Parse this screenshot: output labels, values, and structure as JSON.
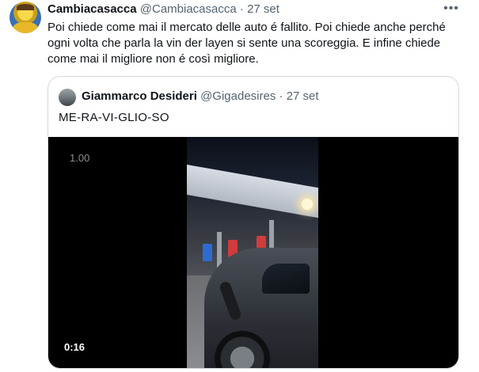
{
  "tweet": {
    "author_name": "Cambiacasacca",
    "author_handle": "@Cambiacasacca",
    "separator": "·",
    "date": "27 set",
    "more_icon": "more-horizontal-icon",
    "text": "Poi chiede come mai il mercato delle auto é fallito. Poi chiede anche perché ogni volta che parla la vin der layen si sente una scoreggia. E infine chiede come mai il migliore non é così migliore."
  },
  "quoted_tweet": {
    "author_name": "Giammarco Desideri",
    "author_handle": "@Gigadesires",
    "separator": "·",
    "date": "27 set",
    "text": "ME-RA-VI-GLIO-SO",
    "video": {
      "speed_label": "1.00",
      "duration": "0:16"
    }
  }
}
